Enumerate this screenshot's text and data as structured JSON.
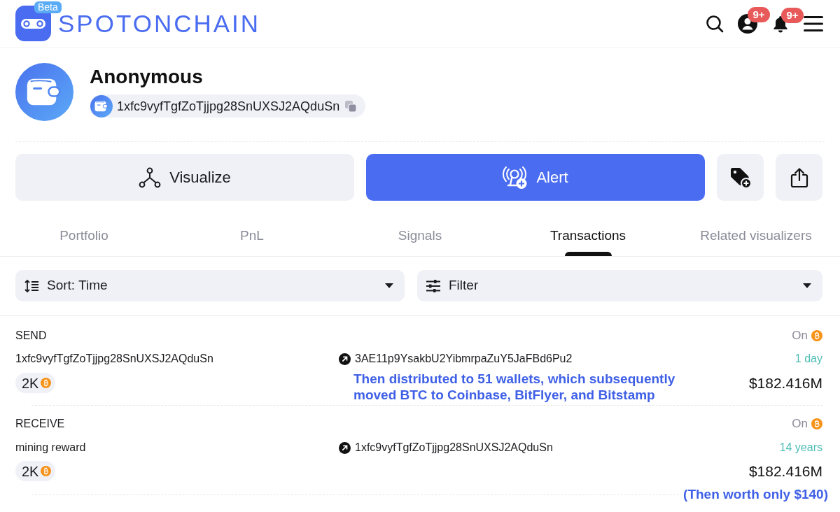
{
  "header": {
    "logo": "SPOTONCHAIN",
    "beta": "Beta",
    "actions": [
      {
        "kind": "search"
      },
      {
        "kind": "user",
        "badge": "9+"
      },
      {
        "kind": "bell",
        "badge": "9+"
      },
      {
        "kind": "menu"
      }
    ]
  },
  "profile": {
    "name": "Anonymous",
    "address": "1xfc9vyfTgfZoTjjpg28SnUXSJ2AQduSn"
  },
  "buttons": [
    {
      "kind": "visualize",
      "label": "Visualize"
    },
    {
      "kind": "alert",
      "label": "Alert"
    },
    {
      "kind": "add_label"
    },
    {
      "kind": "share"
    }
  ],
  "tabs": [
    {
      "label": "Portfolio",
      "selected": false
    },
    {
      "label": "PnL",
      "selected": false
    },
    {
      "label": "Signals",
      "selected": false
    },
    {
      "label": "Transactions",
      "selected": true
    },
    {
      "label": "Related visualizers",
      "selected": false
    }
  ],
  "sort": {
    "label": "Sort: Time"
  },
  "filter": {
    "label": "Filter"
  },
  "transactions": [
    {
      "type": "SEND",
      "status": "On",
      "from": "1xfc9vyfTgfZoTjjpg28SnUXSJ2AQduSn",
      "to": "3AE11p9YsakbU2YibmrpaZuY5JaFBd6Pu2",
      "age": "1 day",
      "amount": "2K",
      "value": "$182.416M",
      "note": "Then distributed to 51 wallets, which subsequently moved BTC to Coinbase, BitFlyer, and Bitstamp"
    },
    {
      "type": "RECEIVE",
      "status": "On",
      "from": "mining reward",
      "to": "1xfc9vyfTgfZoTjjpg28SnUXSJ2AQduSn",
      "age": "14 years",
      "amount": "2K",
      "value": "$182.416M"
    }
  ],
  "annotation": "(Then worth only $140)"
}
